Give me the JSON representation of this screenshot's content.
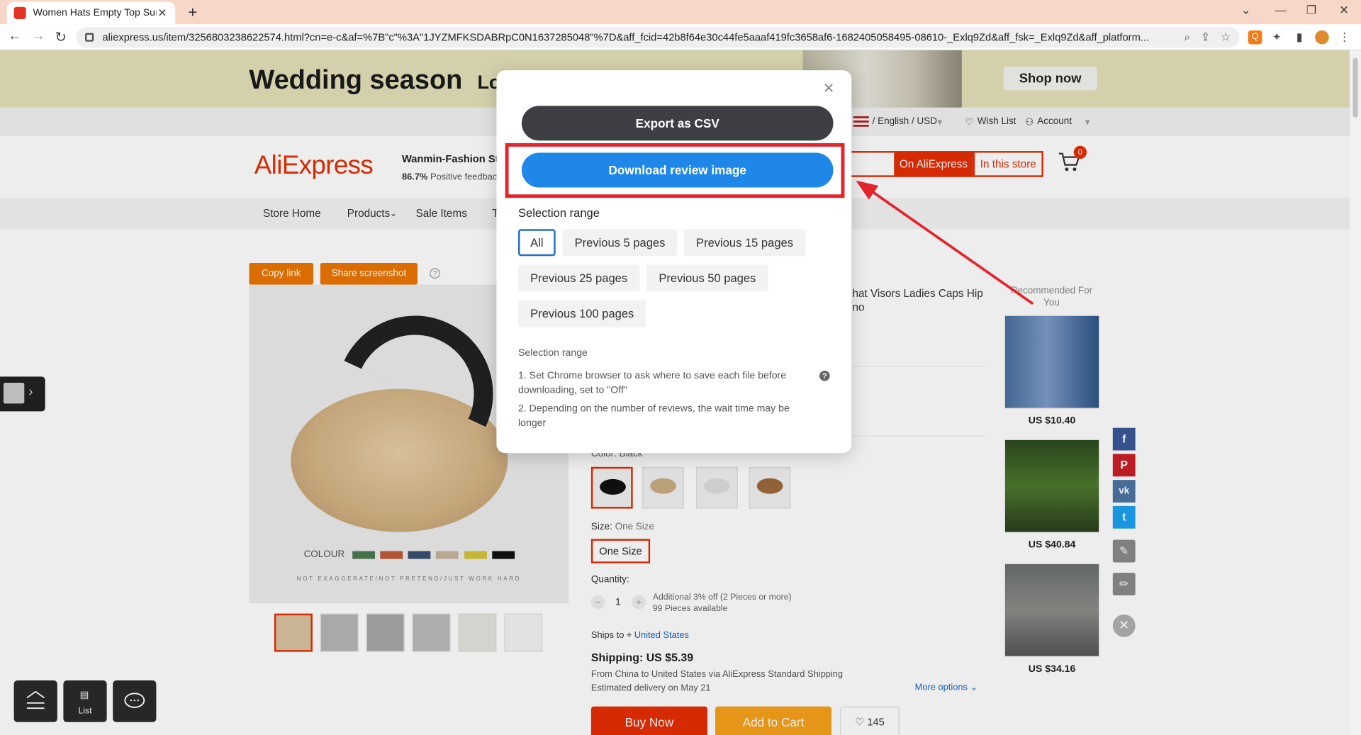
{
  "browser": {
    "tab_title": "Women Hats Empty Top Summ",
    "tab_close": "✕",
    "new_tab": "+",
    "url": "aliexpress.us/item/3256803238622574.html?cn=e-c&af=%7B\"c\"%3A\"1JYZMFKSDABRpC0N1637285048\"%7D&aff_fcid=42b8f64e30c44fe5aaaf419fc3658af6-1682405058495-08610-_Exlq9Zd&aff_fsk=_Exlq9Zd&aff_platform..."
  },
  "banner": {
    "headline": "Wedding season",
    "sub": "Lo",
    "shop_now": "Shop now"
  },
  "topnav": {
    "language_currency": "/ English / USD",
    "wishlist": "Wish List",
    "account": "Account"
  },
  "header": {
    "logo": "AliExpress",
    "store_name": "Wanmin-Fashion St",
    "feedback_pct": "86.7%",
    "feedback_label": "Positive feedback",
    "search_on_ali": "On AliExpress",
    "search_in_store": "In this store",
    "cart_count": "0"
  },
  "storenav": {
    "items": [
      "Store Home",
      "Products",
      "Sale Items",
      "T"
    ]
  },
  "product": {
    "copy_link": "Copy link",
    "share_screenshot": "Share screenshot",
    "help": "?",
    "image_colour_label": "COLOUR",
    "image_swatches": [
      "#4d7a4f",
      "#c0593a",
      "#3b4f6e",
      "#c8b49c",
      "#d6c43a",
      "#111111"
    ],
    "image_tagline": "NOT EXAGGERATE/NOT PRETEND/JUST WORK HARD",
    "title_line1": "hat Visors Ladies Caps Hip",
    "title_line2": "no",
    "color_label": "Color: Black",
    "size_label": "Size:",
    "size_value": "One Size",
    "size_button": "One Size",
    "quantity_label": "Quantity:",
    "quantity_value": "1",
    "qty_minus": "−",
    "qty_plus": "+",
    "qty_info_1": "Additional 3% off (2 Pieces or more)",
    "qty_info_2": "99 Pieces available",
    "ships_to_label": "Ships to",
    "ships_to_country": "United States",
    "shipping": "Shipping: US $5.39",
    "ship_info_1": "From China to United States via AliExpress Standard Shipping",
    "ship_info_2": "Estimated delivery on May 21",
    "more_options": "More options",
    "buy_now": "Buy Now",
    "add_to_cart": "Add to Cart",
    "wish_count": "145"
  },
  "recommended": {
    "heading": "Recommended For You",
    "items": [
      {
        "price": "US $10.40"
      },
      {
        "price": "US $40.84"
      },
      {
        "price": "US $34.16"
      }
    ]
  },
  "social": {
    "facebook": "f",
    "pinterest": "P",
    "vk": "vk",
    "twitter": "t"
  },
  "float_buttons": {
    "list": "List"
  },
  "modal": {
    "close": "✕",
    "export_csv": "Export as CSV",
    "download_review_image": "Download review image",
    "selection_range_title": "Selection range",
    "ranges": [
      "All",
      "Previous 5 pages",
      "Previous 15 pages",
      "Previous 25 pages",
      "Previous 50 pages",
      "Previous 100 pages"
    ],
    "selected_range": "All",
    "notes_title": "Selection range",
    "note_1": "1. Set Chrome browser to ask where to save each file before downloading, set to \"Off\"",
    "note_2": "2. Depending on the number of reviews, the wait time may be longer",
    "note_help": "?"
  },
  "colors": {
    "accent_red": "#e62e04",
    "download_blue": "#1f87e8",
    "export_dark": "#3d3f45",
    "highlight_red": "#e5232c"
  }
}
